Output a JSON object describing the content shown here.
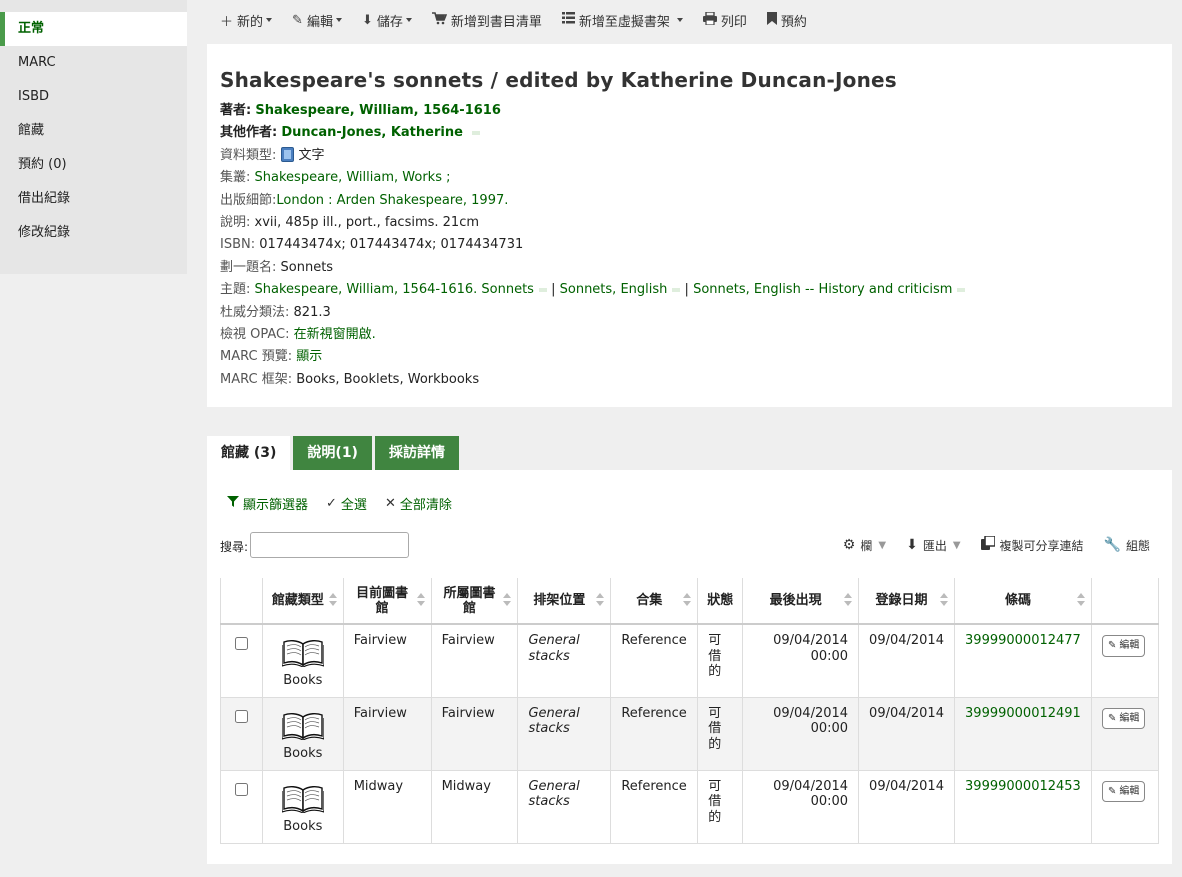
{
  "sidebar": {
    "items": [
      {
        "label": "正常",
        "active": true
      },
      {
        "label": "MARC"
      },
      {
        "label": "ISBD"
      },
      {
        "label": "館藏"
      },
      {
        "label": "預約 (0)"
      },
      {
        "label": "借出紀錄"
      },
      {
        "label": "修改紀錄"
      }
    ]
  },
  "toolbar": {
    "new": "新的",
    "edit": "編輯",
    "save": "儲存",
    "add_to_cart": "新增到書目清單",
    "add_to_list": "新增至虛擬書架",
    "print": "列印",
    "hold": "預約"
  },
  "record": {
    "title": "Shakespeare's sonnets / edited by Katherine Duncan-Jones",
    "author_label": "著者:",
    "author": "Shakespeare, William, 1564-1616",
    "other_author_label": "其他作者:",
    "other_author": "Duncan-Jones, Katherine",
    "material_label": "資料類型:",
    "material": "文字",
    "series_label": "集叢:",
    "series": "Shakespeare, William, Works ;",
    "publication_label": "出版細節:",
    "publication": "London : Arden Shakespeare, 1997.",
    "description_label": "說明:",
    "description": "xvii, 485p ill., port., facsims. 21cm",
    "isbn_label": "ISBN:",
    "isbn": "017443474x; 017443474x; 0174434731",
    "uniform_title_label": "劃一題名:",
    "uniform_title": "Sonnets",
    "subject_label": "主題:",
    "subjects": [
      "Shakespeare, William, 1564-1616. Sonnets",
      "Sonnets, English",
      "Sonnets, English -- History and criticism"
    ],
    "subject_sep": "|",
    "ddc_label": "杜威分類法:",
    "ddc": "821.3",
    "opac_label": "檢視 OPAC:",
    "opac": "在新視窗開啟.",
    "marc_preview_label": "MARC 預覽:",
    "marc_preview": "顯示",
    "marc_framework_label": "MARC 框架:",
    "marc_framework": "Books, Booklets, Workbooks"
  },
  "tabs": [
    {
      "label": "館藏 (3)",
      "active": true
    },
    {
      "label": "說明(1)"
    },
    {
      "label": "採訪詳情"
    }
  ],
  "holdings": {
    "show_filters": "顯示篩選器",
    "select_all": "全選",
    "clear_all": "全部清除",
    "search_label": "搜尋:",
    "columns_btn": "欄",
    "export_btn": "匯出",
    "copy_link_btn": "複製可分享連結",
    "config_btn": "組態",
    "columns": [
      "館藏類型",
      "目前圖書館",
      "所屬圖書館",
      "排架位置",
      "合集",
      "狀態",
      "最後出現",
      "登錄日期",
      "條碼"
    ],
    "rows": [
      {
        "itype": "Books",
        "current": "Fairview",
        "home": "Fairview",
        "location": "General stacks",
        "collection": "Reference",
        "status": "可借的",
        "last_seen": "09/04/2014 00:00",
        "accession": "09/04/2014",
        "barcode": "39999000012477"
      },
      {
        "itype": "Books",
        "current": "Fairview",
        "home": "Fairview",
        "location": "General stacks",
        "collection": "Reference",
        "status": "可借的",
        "last_seen": "09/04/2014 00:00",
        "accession": "09/04/2014",
        "barcode": "39999000012491"
      },
      {
        "itype": "Books",
        "current": "Midway",
        "home": "Midway",
        "location": "General stacks",
        "collection": "Reference",
        "status": "可借的",
        "last_seen": "09/04/2014 00:00",
        "accession": "09/04/2014",
        "barcode": "39999000012453"
      }
    ],
    "edit_label": "編輯"
  }
}
